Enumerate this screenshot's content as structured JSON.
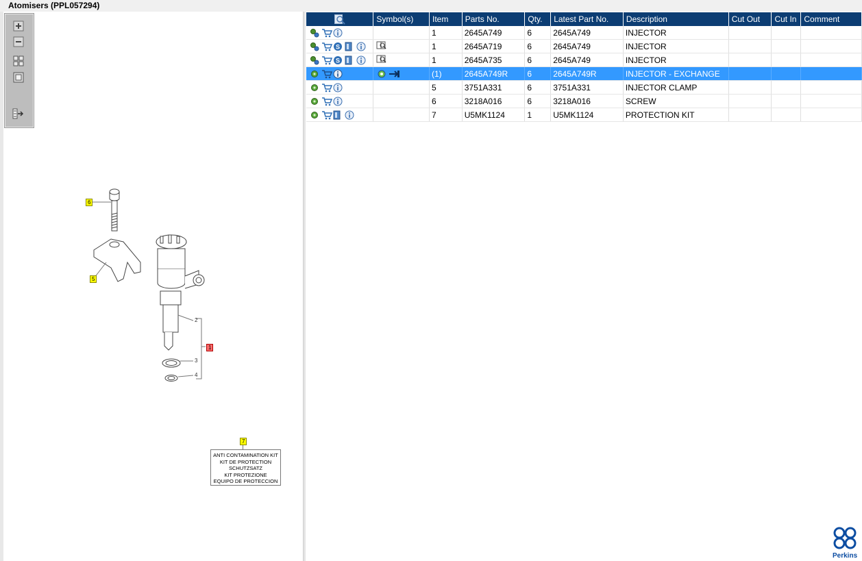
{
  "window": {
    "title": "Atomisers (PPL057294)"
  },
  "colors": {
    "header_bg": "#0c3d73",
    "selected_row": "#3399ff",
    "callout_yellow": "#ffff00",
    "callout_red": "#ff6b6b",
    "brand_blue": "#0c4da2"
  },
  "zoom_toolbar": {
    "buttons": [
      {
        "name": "zoom-in-button",
        "icon": "plus-icon"
      },
      {
        "name": "zoom-out-button",
        "icon": "minus-icon"
      },
      {
        "name": "fit-all-button",
        "icon": "grid-icon"
      },
      {
        "name": "fit-window-button",
        "icon": "square-icon"
      },
      {
        "name": "export-button",
        "icon": "export-icon"
      }
    ]
  },
  "table": {
    "headers": {
      "search_icon": "magnifier-icon",
      "symbols": "Symbol(s)",
      "item": "Item",
      "parts_no": "Parts No.",
      "qty": "Qty.",
      "latest_part_no": "Latest Part No.",
      "description": "Description",
      "cut_out": "Cut Out",
      "cut_in": "Cut In",
      "comment": "Comment"
    },
    "rows": [
      {
        "item": "1",
        "parts_no": "2645A749",
        "qty": "6",
        "latest_part_no": "2645A749",
        "description": "INJECTOR",
        "cut_out": "",
        "cut_in": "",
        "comment": "",
        "selected": false
      },
      {
        "item": "1",
        "parts_no": "2645A719",
        "qty": "6",
        "latest_part_no": "2645A749",
        "description": "INJECTOR",
        "cut_out": "",
        "cut_in": "",
        "comment": "",
        "selected": false
      },
      {
        "item": "1",
        "parts_no": "2645A735",
        "qty": "6",
        "latest_part_no": "2645A749",
        "description": "INJECTOR",
        "cut_out": "",
        "cut_in": "",
        "comment": "",
        "selected": false
      },
      {
        "item": "(1)",
        "parts_no": "2645A749R",
        "qty": "6",
        "latest_part_no": "2645A749R",
        "description": "INJECTOR - EXCHANGE",
        "cut_out": "",
        "cut_in": "",
        "comment": "",
        "selected": true
      },
      {
        "item": "5",
        "parts_no": "3751A331",
        "qty": "6",
        "latest_part_no": "3751A331",
        "description": "INJECTOR CLAMP",
        "cut_out": "",
        "cut_in": "",
        "comment": "",
        "selected": false
      },
      {
        "item": "6",
        "parts_no": "3218A016",
        "qty": "6",
        "latest_part_no": "3218A016",
        "description": "SCREW",
        "cut_out": "",
        "cut_in": "",
        "comment": "",
        "selected": false
      },
      {
        "item": "7",
        "parts_no": "U5MK1124",
        "qty": "1",
        "latest_part_no": "U5MK1124",
        "description": "PROTECTION KIT",
        "cut_out": "",
        "cut_in": "",
        "comment": "",
        "selected": false
      }
    ]
  },
  "diagram": {
    "callouts": {
      "c6": "6",
      "c5": "5",
      "c1": "1",
      "c7": "7"
    },
    "labels": {
      "l2": "2",
      "l3": "3",
      "l4": "4"
    },
    "kit_box": [
      "ANTI CONTAMINATION KIT",
      "KIT DE PROTECTION",
      "SCHUTZSATZ",
      "KIT PROTEZIONE",
      "EQUIPO DE PROTECCION"
    ]
  },
  "brand": {
    "logo_text": "Perkins"
  }
}
